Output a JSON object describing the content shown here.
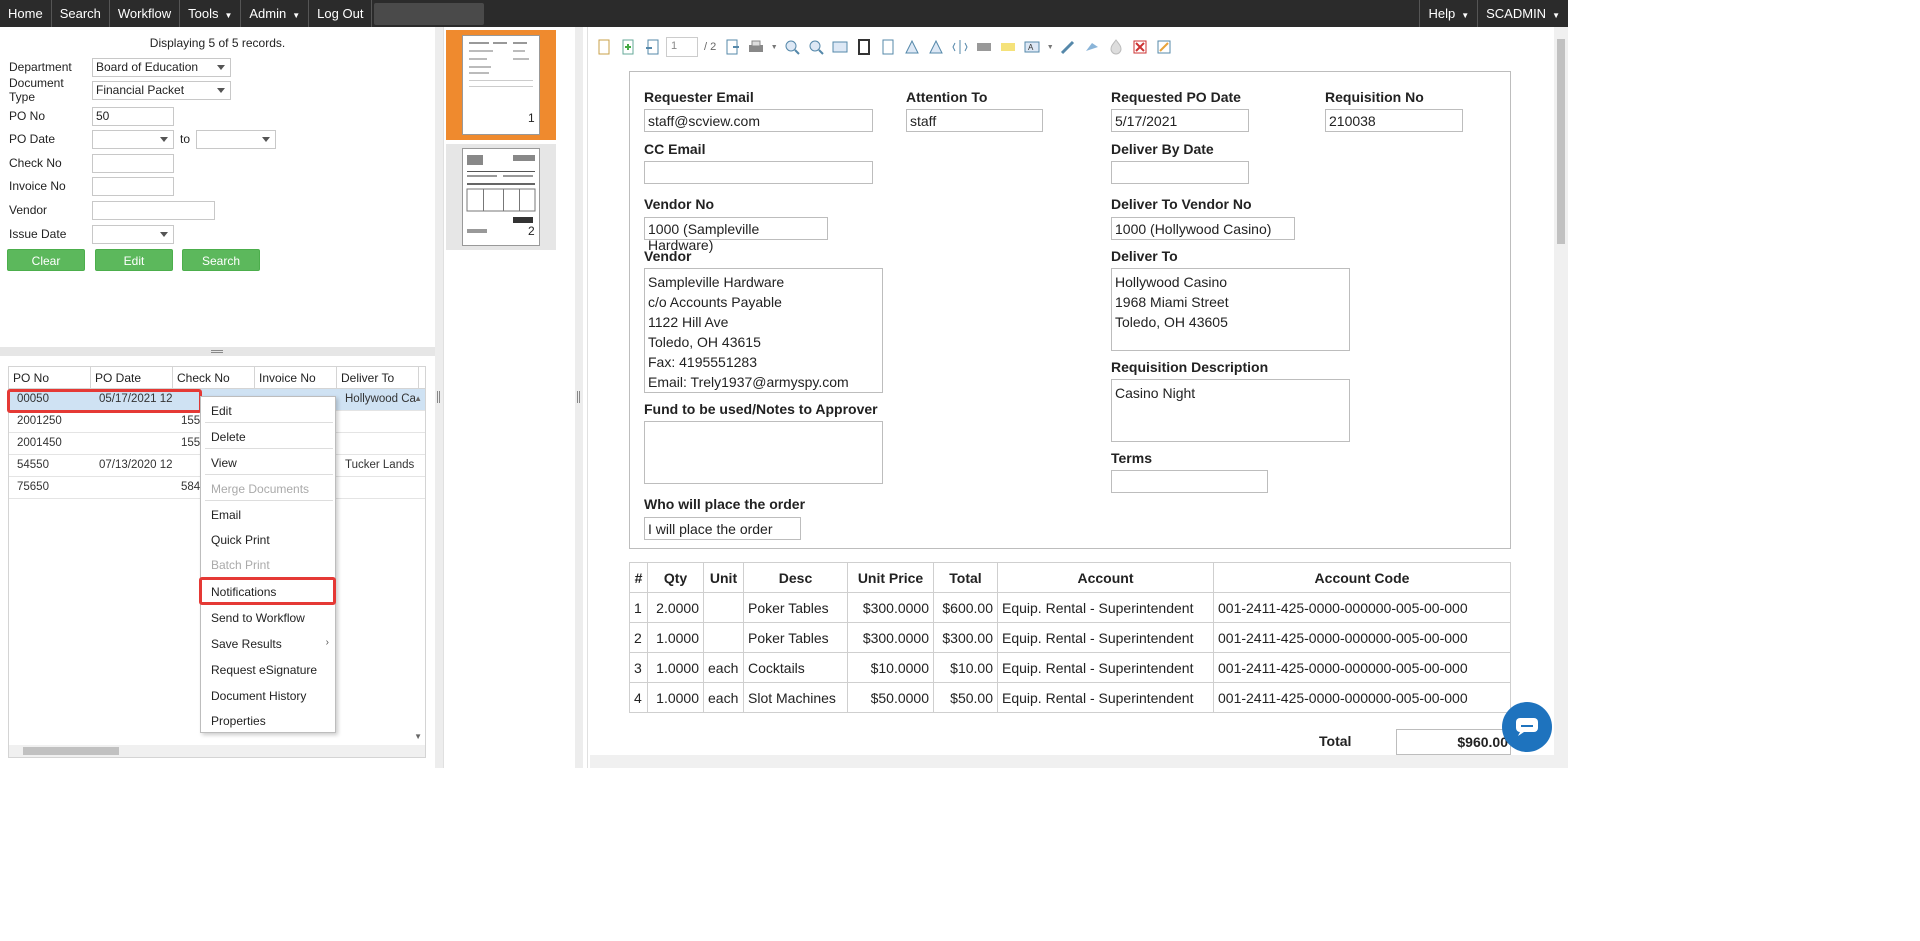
{
  "nav": {
    "left": [
      "Home",
      "Search",
      "Workflow",
      "Tools",
      "Admin",
      "Log Out"
    ],
    "right": [
      "Help",
      "SCADMIN"
    ]
  },
  "search": {
    "displaying": "Displaying 5 of 5 records.",
    "labels": {
      "department": "Department",
      "doc_type": "Document Type",
      "po_no": "PO No",
      "po_date": "PO Date",
      "to": "to",
      "check_no": "Check No",
      "invoice_no": "Invoice No",
      "vendor": "Vendor",
      "issue_date": "Issue Date"
    },
    "values": {
      "department": "Board of Education",
      "doc_type": "Financial Packet",
      "po_no": "50"
    },
    "buttons": {
      "clear": "Clear",
      "edit": "Edit",
      "search": "Search"
    }
  },
  "grid": {
    "headers": [
      "PO No",
      "PO Date",
      "Check No",
      "Invoice No",
      "Deliver To"
    ],
    "rows": [
      [
        "00050",
        "05/17/2021 12",
        "",
        "",
        "Hollywood Ca"
      ],
      [
        "2001250",
        "",
        "155",
        "",
        ""
      ],
      [
        "2001450",
        "",
        "155",
        "",
        ""
      ],
      [
        "54550",
        "07/13/2020 12",
        "",
        "",
        "Tucker Lands"
      ],
      [
        "75650",
        "",
        "584",
        "",
        ""
      ]
    ]
  },
  "context_menu": {
    "items": [
      "Edit",
      "Delete",
      "View",
      "Merge Documents",
      "Email",
      "Quick Print",
      "Batch Print",
      "Notifications",
      "Send to Workflow",
      "Save Results",
      "Request eSignature",
      "Document History",
      "Properties"
    ]
  },
  "thumbs": {
    "p1": "1",
    "p2": "2"
  },
  "viewer": {
    "page_input": "1",
    "page_of": "/ 2"
  },
  "form": {
    "requester_email_label": "Requester Email",
    "requester_email": "staff@scview.com",
    "attention_to_label": "Attention To",
    "attention_to": "staff",
    "requested_po_date_label": "Requested PO Date",
    "requested_po_date": "5/17/2021",
    "requisition_no_label": "Requisition No",
    "requisition_no": "210038",
    "cc_email_label": "CC Email",
    "deliver_by_date_label": "Deliver By Date",
    "vendor_no_label": "Vendor No",
    "vendor_no": "1000 (Sampleville Hardware)",
    "deliver_to_vendor_no_label": "Deliver To Vendor No",
    "deliver_to_vendor_no": "1000 (Hollywood Casino)",
    "vendor_label": "Vendor",
    "vendor_lines": [
      "Sampleville Hardware",
      "c/o Accounts Payable",
      "1122 Hill Ave",
      "Toledo, OH 43615",
      "Fax: 4195551283",
      "Email: Trely1937@armyspy.com"
    ],
    "deliver_to_label": "Deliver To",
    "deliver_to_lines": [
      "Hollywood Casino",
      "1968 Miami Street",
      "Toledo, OH 43605"
    ],
    "requisition_desc_label": "Requisition Description",
    "requisition_desc": "Casino Night",
    "fund_label": "Fund to be used/Notes to Approver",
    "terms_label": "Terms",
    "who_label": "Who will place the order",
    "who_value": "I will place the order"
  },
  "items": {
    "headers": [
      "#",
      "Qty",
      "Unit",
      "Desc",
      "Unit Price",
      "Total",
      "Account",
      "Account Code"
    ],
    "rows": [
      [
        "1",
        "2.0000",
        "",
        "Poker Tables",
        "$300.0000",
        "$600.00",
        "Equip. Rental - Superintendent",
        "001-2411-425-0000-000000-005-00-000"
      ],
      [
        "2",
        "1.0000",
        "",
        "Poker Tables",
        "$300.0000",
        "$300.00",
        "Equip. Rental - Superintendent",
        "001-2411-425-0000-000000-005-00-000"
      ],
      [
        "3",
        "1.0000",
        "each",
        "Cocktails",
        "$10.0000",
        "$10.00",
        "Equip. Rental - Superintendent",
        "001-2411-425-0000-000000-005-00-000"
      ],
      [
        "4",
        "1.0000",
        "each",
        "Slot Machines",
        "$50.0000",
        "$50.00",
        "Equip. Rental - Superintendent",
        "001-2411-425-0000-000000-005-00-000"
      ]
    ],
    "total_label": "Total",
    "total_value": "$960.00"
  },
  "colors": {
    "accent_orange": "#ef8a2e",
    "green_button": "#5cb85c",
    "highlight_red": "#e53935",
    "nav_bg": "#2b2b2b"
  }
}
